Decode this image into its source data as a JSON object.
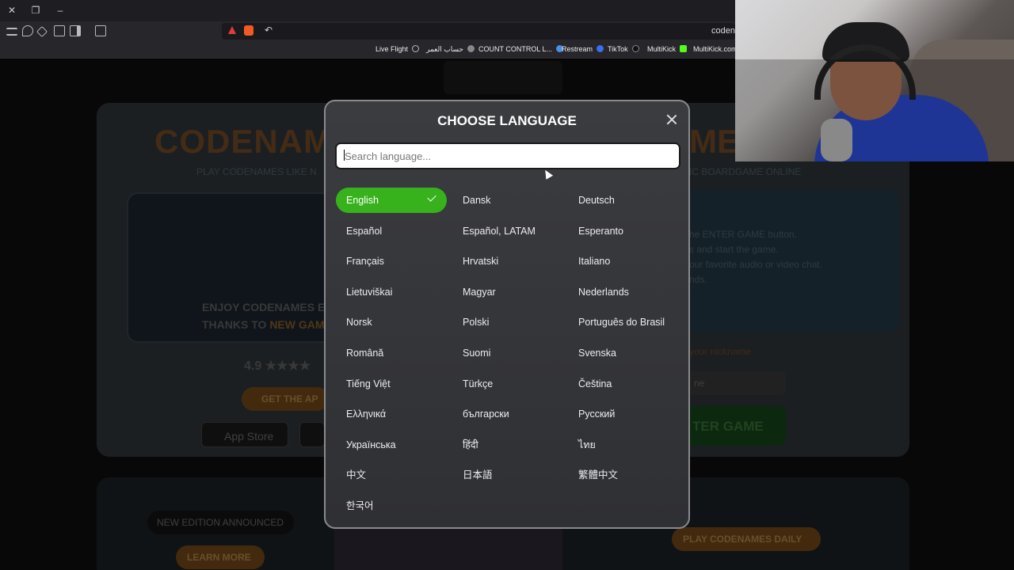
{
  "browser": {
    "url": "coden",
    "bookmarks": [
      {
        "label": "Live Flight",
        "color": "#bbbbbb"
      },
      {
        "label": "حساب العمر",
        "color": "#888888"
      },
      {
        "label": "COUNT CONTROL L...",
        "color": "#4a8fe0"
      },
      {
        "label": "Restream",
        "color": "#3a6df0"
      },
      {
        "label": "TikTok",
        "color": "#111111"
      },
      {
        "label": "MultiKick",
        "color": "#53fc18"
      },
      {
        "label": "MultiKick.com",
        "color": "#53fc18"
      }
    ]
  },
  "site": {
    "logo_left": "CODENAM",
    "logo_right": "ME",
    "tagline_left": "PLAY CODENAMES LIKE N",
    "tagline_right": "IC BOARDGAME ONLINE",
    "enjoy_line1": "ENJOY CODENAMES E",
    "enjoy_line2_prefix": "THANKS TO",
    "enjoy_line2_highlight": "NEW GAM",
    "rating": "4.9 ★★★★",
    "get_app": "GET THE AP",
    "app_store": "App Store",
    "instructions": [
      "he ENTER GAME button.",
      "s and start the game.",
      "our favorite audio or video chat.",
      "nds."
    ],
    "nickname_label": "your nickname",
    "nickname_placeholder": "ne",
    "enter_game": "TER GAME",
    "new_edition": "NEW EDITION ANNOUNCED",
    "learn_more": "LEARN MORE",
    "play_daily": "PLAY CODENAMES DAILY"
  },
  "modal": {
    "title": "CHOOSE LANGUAGE",
    "search_placeholder": "Search language...",
    "selected": "English",
    "languages": [
      "English",
      "Dansk",
      "Deutsch",
      "Español",
      "Español, LATAM",
      "Esperanto",
      "Français",
      "Hrvatski",
      "Italiano",
      "Lietuviškai",
      "Magyar",
      "Nederlands",
      "Norsk",
      "Polski",
      "Português do Brasil",
      "Română",
      "Suomi",
      "Svenska",
      "Tiếng Việt",
      "Türkçe",
      "Čeština",
      "Ελληνικά",
      "български",
      "Русский",
      "Українська",
      "हिंदी",
      "ไทย",
      "中文",
      "日本語",
      "繁體中文",
      "한국어"
    ]
  },
  "colors": {
    "selected_bg": "#37b21c",
    "modal_bg": "#36373b"
  }
}
